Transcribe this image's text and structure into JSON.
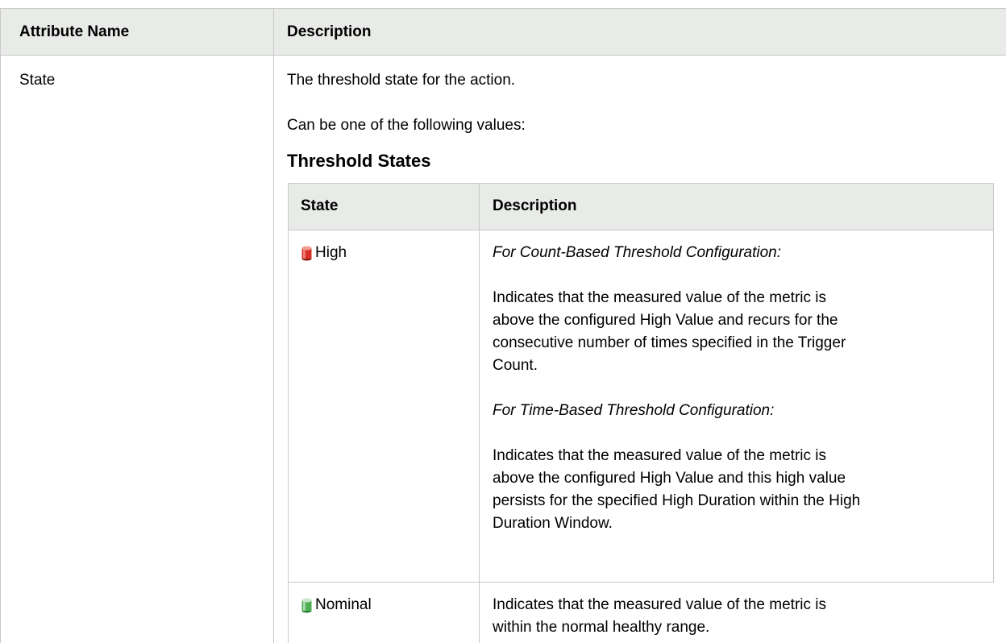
{
  "outer_table": {
    "headers": {
      "attribute_name": "Attribute Name",
      "description": "Description"
    },
    "rows": [
      {
        "attribute": "State",
        "description_lines": [
          "The threshold state for the action.",
          "Can be one of the following values:"
        ]
      }
    ]
  },
  "threshold_table": {
    "caption": "Threshold States",
    "headers": {
      "state": "State",
      "description": "Description"
    },
    "rows": [
      {
        "state": "High",
        "icon": "red-cylinder-icon",
        "icon_color": "#d93025",
        "count_based_title": "For Count-Based Threshold Configuration:",
        "count_based_lines": [
          "Indicates that the measured value of the metric is",
          "above the configured High Value and recurs for the",
          "consecutive number of times specified in the Trigger",
          "Count."
        ],
        "time_based_title": "For Time-Based Threshold Configuration:",
        "time_based_lines": [
          "Indicates that the measured value of the metric is",
          "above the configured High Value and this high value",
          "persists for the specified High Duration within the High",
          "Duration Window."
        ]
      },
      {
        "state": "Nominal",
        "icon": "green-cylinder-icon",
        "icon_color": "#4caf50",
        "description_lines": [
          "Indicates that the measured value of the metric is",
          "within the normal healthy range."
        ]
      }
    ]
  }
}
